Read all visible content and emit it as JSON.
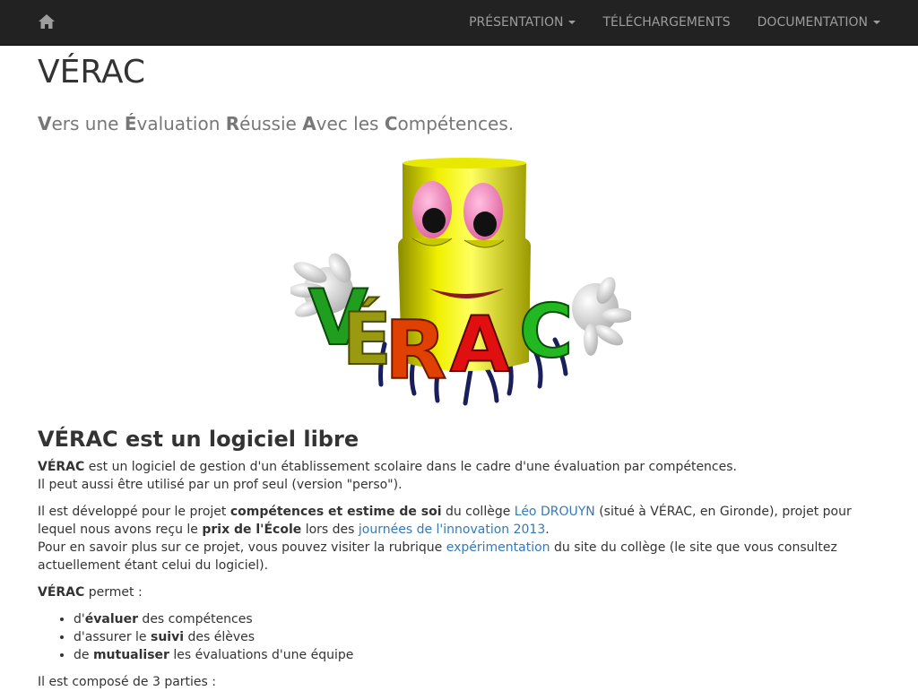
{
  "nav": {
    "items": [
      {
        "label": "PRÉSENTATION",
        "dropdown": true
      },
      {
        "label": "TÉLÉCHARGEMENTS",
        "dropdown": false
      },
      {
        "label": "DOCUMENTATION",
        "dropdown": true
      }
    ],
    "home_icon": "home-icon"
  },
  "page": {
    "title": "VÉRAC",
    "tagline": [
      {
        "b": "V",
        "t": "ers une "
      },
      {
        "b": "É",
        "t": "valuation "
      },
      {
        "b": "R",
        "t": "éussie "
      },
      {
        "b": "A",
        "t": "vec les "
      },
      {
        "b": "C",
        "t": "ompétences."
      }
    ],
    "logo_letters": "VÉRAC"
  },
  "section": {
    "heading_bold": "VÉRAC",
    "heading_rest": " est un logiciel libre",
    "p1_bold": "VÉRAC",
    "p1_rest": " est un logiciel de gestion d'un établissement scolaire dans le cadre d'une évaluation par compétences.",
    "p1_line2": "Il peut aussi être utilisé par un prof seul (version \"perso\").",
    "p2": {
      "t1": "Il est développé pour le projet ",
      "b1": "compétences et estime de soi",
      "t2": " du collège ",
      "link1": "Léo DROUYN",
      "t3": " (situé à VÉRAC, en Gironde), projet pour",
      "t4": "lequel nous avons reçu le ",
      "b2": "prix de l'École",
      "t5": " lors des ",
      "link2": "journées de l'innovation 2013",
      "t6": ".",
      "t7": "Pour en savoir plus sur ce projet, vous pouvez visiter la rubrique ",
      "link3": "expérimentation",
      "t8": " du site du collège (le site que vous consultez",
      "t9": "actuellement étant celui du logiciel)."
    },
    "p3_bold": "VÉRAC",
    "p3_rest": " permet :",
    "list": [
      {
        "pre": "d'",
        "b": "évaluer",
        "post": " des compétences"
      },
      {
        "pre": "d'assurer le ",
        "b": "suivi",
        "post": " des élèves"
      },
      {
        "pre": "de ",
        "b": "mutualiser",
        "post": " les évaluations d'une équipe"
      }
    ],
    "p4": "Il est composé de 3 parties :"
  }
}
